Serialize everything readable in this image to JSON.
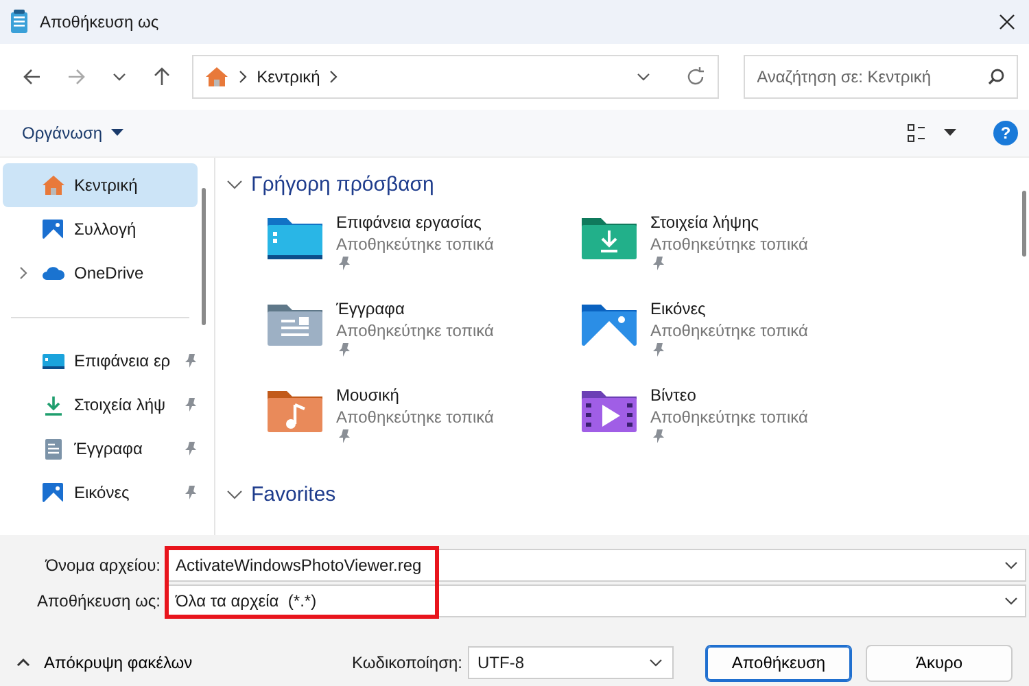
{
  "window": {
    "title": "Αποθήκευση ως"
  },
  "address": {
    "crumbs": [
      "Κεντρική"
    ]
  },
  "search": {
    "placeholder": "Αναζήτηση σε: Κεντρική"
  },
  "toolbar": {
    "organize": "Οργάνωση",
    "help": "?"
  },
  "sidebar": {
    "groups": [
      {
        "items": [
          {
            "label": "Κεντρική",
            "kind": "home",
            "selected": true,
            "expandable": false,
            "pinned": false
          },
          {
            "label": "Συλλογή",
            "kind": "gallery",
            "selected": false,
            "expandable": false,
            "pinned": false
          },
          {
            "label": "OneDrive",
            "kind": "cloud",
            "selected": false,
            "expandable": true,
            "pinned": false
          }
        ]
      },
      {
        "items": [
          {
            "label": "Επιφάνεια ερ",
            "kind": "desktop",
            "selected": false,
            "expandable": false,
            "pinned": true
          },
          {
            "label": "Στοιχεία λήψ",
            "kind": "download",
            "selected": false,
            "expandable": false,
            "pinned": true
          },
          {
            "label": "Έγγραφα",
            "kind": "documents",
            "selected": false,
            "expandable": false,
            "pinned": true
          },
          {
            "label": "Εικόνες",
            "kind": "pictures",
            "selected": false,
            "expandable": false,
            "pinned": true
          }
        ]
      }
    ]
  },
  "sections": [
    {
      "title": "Γρήγορη πρόσβαση",
      "expanded": true,
      "items": [
        {
          "name": "Επιφάνεια εργασίας",
          "status": "Αποθηκεύτηκε τοπικά",
          "kind": "desktop",
          "pinned": true
        },
        {
          "name": "Στοιχεία λήψης",
          "status": "Αποθηκεύτηκε τοπικά",
          "kind": "download",
          "pinned": true
        },
        {
          "name": "Έγγραφα",
          "status": "Αποθηκεύτηκε τοπικά",
          "kind": "documents",
          "pinned": true
        },
        {
          "name": "Εικόνες",
          "status": "Αποθηκεύτηκε τοπικά",
          "kind": "pictures",
          "pinned": true
        },
        {
          "name": "Μουσική",
          "status": "Αποθηκεύτηκε τοπικά",
          "kind": "music",
          "pinned": true
        },
        {
          "name": "Βίντεο",
          "status": "Αποθηκεύτηκε τοπικά",
          "kind": "video",
          "pinned": true
        }
      ]
    },
    {
      "title": "Favorites",
      "expanded": true
    }
  ],
  "fields": [
    {
      "label": "Όνομα αρχείου:",
      "value": "ActivateWindowsPhotoViewer.reg"
    },
    {
      "label": "Αποθήκευση ως:",
      "value": "Όλα τα αρχεία  (*.*)"
    }
  ],
  "footer": {
    "toggle": "Απόκρυψη φακέλων",
    "encoding_label": "Κωδικοποίηση:",
    "encoding": "UTF-8",
    "buttons": [
      {
        "label": "Αποθήκευση",
        "primary": true
      },
      {
        "label": "Άκυρο",
        "primary": false
      }
    ]
  }
}
